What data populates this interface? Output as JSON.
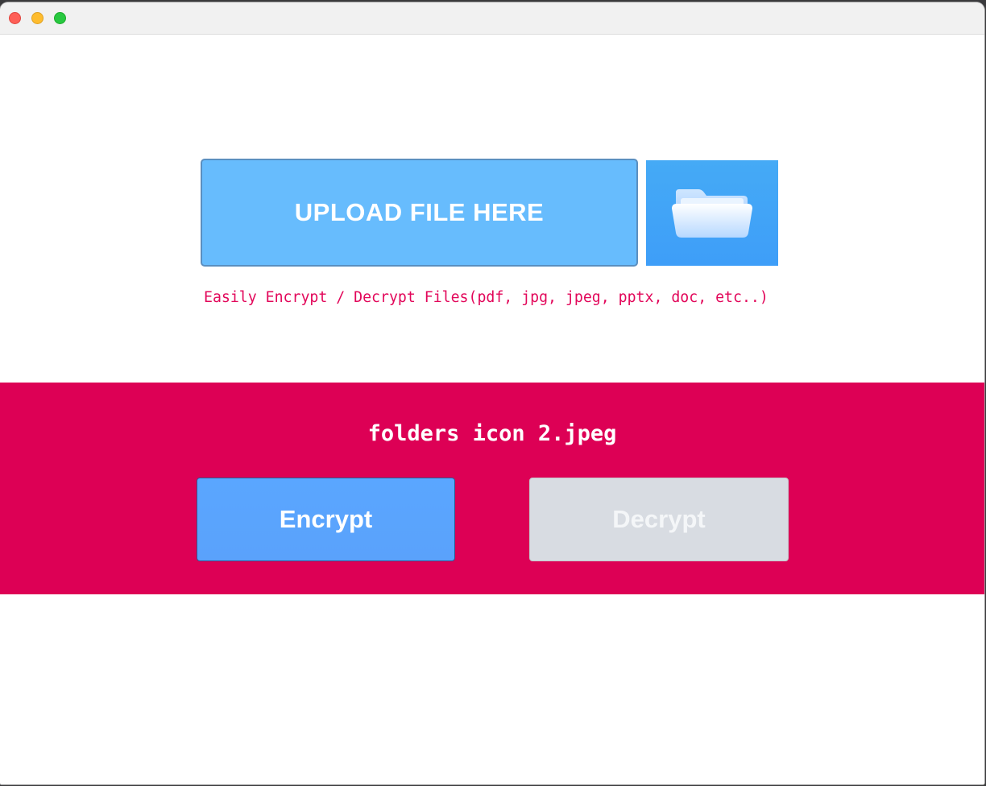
{
  "window": {
    "controls": [
      "close",
      "minimize",
      "maximize"
    ]
  },
  "upload": {
    "label": "UPLOAD FILE HERE",
    "folder_icon": "folder-open-icon"
  },
  "hint": "Easily Encrypt / Decrypt Files(pdf, jpg, jpeg, pptx, doc, etc..)",
  "selected_file": "folders icon 2.jpeg",
  "actions": {
    "encrypt_label": "Encrypt",
    "decrypt_label": "Decrypt"
  },
  "colors": {
    "accent_band": "#dd0055",
    "upload_blue": "#67bcfd",
    "encrypt_blue": "#5aa6ff",
    "decrypt_gray": "#d8dce2",
    "hint_text": "#e2075a"
  }
}
